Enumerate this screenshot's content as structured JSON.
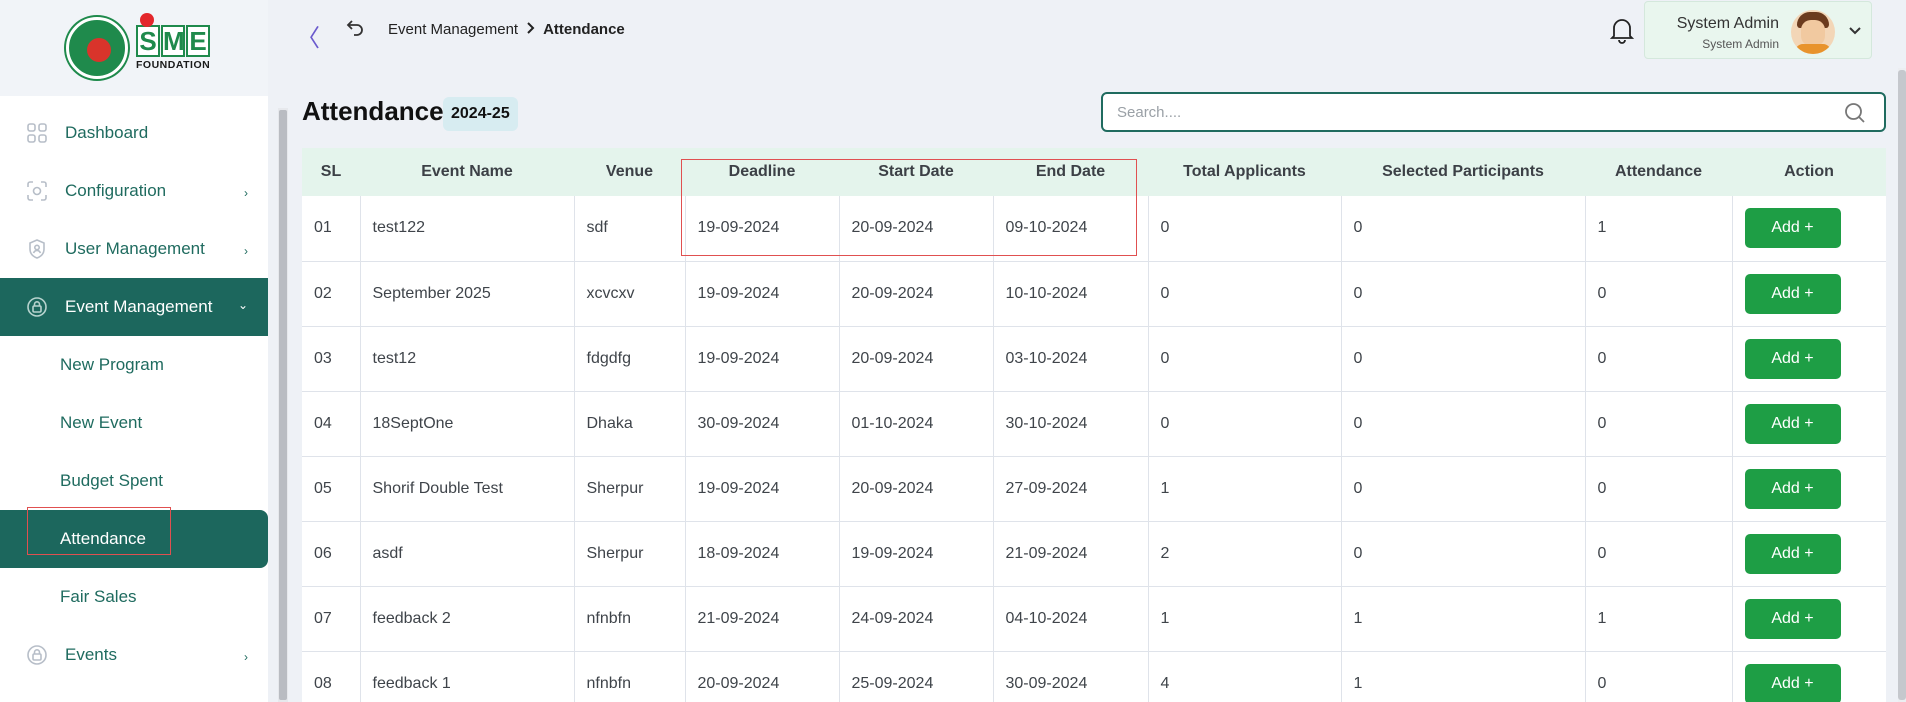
{
  "brand": {
    "logo_sme": "SME",
    "logo_foundation": "FOUNDATION"
  },
  "sidebar": {
    "items": [
      {
        "label": "Dashboard",
        "icon": "grid-icon"
      },
      {
        "label": "Configuration",
        "icon": "config-icon"
      },
      {
        "label": "User Management",
        "icon": "shield-user-icon"
      },
      {
        "label": "Event Management",
        "icon": "lock-icon"
      },
      {
        "label": "Events",
        "icon": "lock-icon"
      }
    ],
    "sub_items": [
      "New Program",
      "New Event",
      "Budget Spent",
      "Attendance",
      "Fair Sales"
    ]
  },
  "topbar": {
    "breadcrumb_parent": "Event Management",
    "breadcrumb_current": "Attendance",
    "user_name": "System Admin",
    "user_role": "System Admin"
  },
  "main": {
    "title": "Attendance",
    "year": "2024-25",
    "search_placeholder": "Search...."
  },
  "table": {
    "headers": [
      "SL",
      "Event Name",
      "Venue",
      "Deadline",
      "Start Date",
      "End Date",
      "Total Applicants",
      "Selected Participants",
      "Attendance",
      "Action"
    ],
    "action_label": "Add +",
    "rows": [
      [
        "01",
        "test122",
        "sdf",
        "19-09-2024",
        "20-09-2024",
        "09-10-2024",
        "0",
        "0",
        "1"
      ],
      [
        "02",
        "September 2025",
        "xcvcxv",
        "19-09-2024",
        "20-09-2024",
        "10-10-2024",
        "0",
        "0",
        "0"
      ],
      [
        "03",
        "test12",
        "fdgdfg",
        "19-09-2024",
        "20-09-2024",
        "03-10-2024",
        "0",
        "0",
        "0"
      ],
      [
        "04",
        "18SeptOne",
        "Dhaka",
        "30-09-2024",
        "01-10-2024",
        "30-10-2024",
        "0",
        "0",
        "0"
      ],
      [
        "05",
        "Shorif Double Test",
        "Sherpur",
        "19-09-2024",
        "20-09-2024",
        "27-09-2024",
        "1",
        "0",
        "0"
      ],
      [
        "06",
        "asdf",
        "Sherpur",
        "18-09-2024",
        "19-09-2024",
        "21-09-2024",
        "2",
        "0",
        "0"
      ],
      [
        "07",
        "feedback 2",
        "nfnbfn",
        "21-09-2024",
        "24-09-2024",
        "04-10-2024",
        "1",
        "1",
        "1"
      ],
      [
        "08",
        "feedback 1",
        "nfnbfn",
        "20-09-2024",
        "25-09-2024",
        "30-09-2024",
        "4",
        "1",
        "0"
      ]
    ]
  },
  "colors": {
    "primary": "#1c675d",
    "button": "#1e9e45",
    "header_bg": "#e4f4ec",
    "highlight": "#e05050"
  }
}
